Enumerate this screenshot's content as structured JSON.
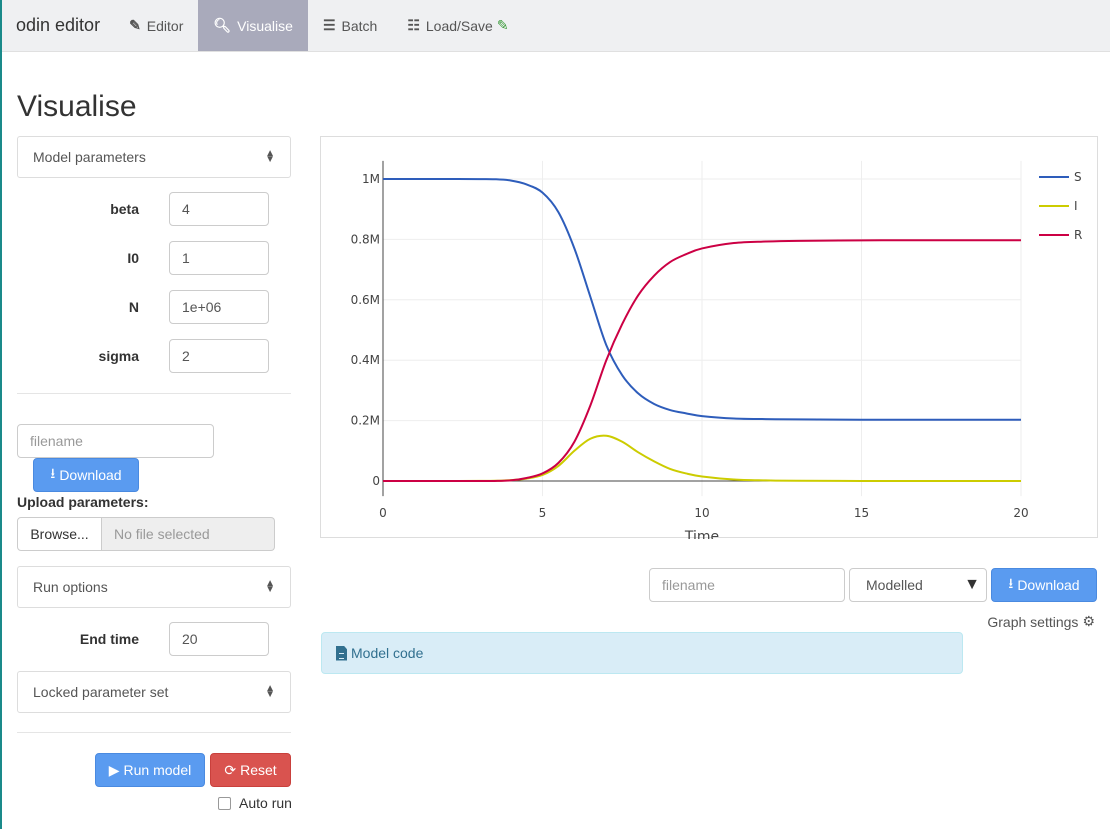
{
  "navbar": {
    "brand": "odin editor",
    "tabs": [
      {
        "label": "Editor",
        "icon": "edit-icon",
        "active": false
      },
      {
        "label": "Visualise",
        "icon": "search-icon",
        "active": true
      },
      {
        "label": "Batch",
        "icon": "bars-icon",
        "active": false
      },
      {
        "label": "Load/Save",
        "icon": "list-icon",
        "active": false,
        "badge_icon": "edit-icon"
      }
    ]
  },
  "page_title": "Visualise",
  "sidebar": {
    "model_parameters_label": "Model parameters",
    "parameters": [
      {
        "name": "beta",
        "value": "4"
      },
      {
        "name": "I0",
        "value": "1"
      },
      {
        "name": "N",
        "value": "1e+06"
      },
      {
        "name": "sigma",
        "value": "2"
      }
    ],
    "filename_placeholder": "filename",
    "download_label": "Download",
    "upload_label": "Upload parameters:",
    "browse_label": "Browse...",
    "no_file_label": "No file selected",
    "run_options_label": "Run options",
    "end_time_label": "End time",
    "end_time_value": "20",
    "locked_parameter_set_label": "Locked parameter set",
    "run_model_label": "Run model",
    "reset_label": "Reset",
    "auto_run_label": "Auto run",
    "auto_run_checked": false
  },
  "main": {
    "filename_placeholder": "filename",
    "select_value": "Modelled",
    "download_label": "Download",
    "graph_settings_label": "Graph settings",
    "model_code_label": "Model code"
  },
  "colors": {
    "S": "#2e5dbb",
    "I": "#cccc00",
    "R": "#cc0044",
    "primary": "#5a9bf0",
    "danger": "#d9534f",
    "active_tab": "#a9aabb"
  },
  "chart_data": {
    "type": "line",
    "title": "",
    "xlabel": "Time",
    "ylabel": "",
    "xlim": [
      0,
      20
    ],
    "ylim": [
      -50000,
      1060000
    ],
    "xticks": [
      0,
      5,
      10,
      15,
      20
    ],
    "yticks": [
      0,
      200000,
      400000,
      600000,
      800000,
      1000000
    ],
    "ytick_labels": [
      "0",
      "0.2M",
      "0.4M",
      "0.6M",
      "0.8M",
      "1M"
    ],
    "grid": true,
    "legend_position": "top-right",
    "x": [
      0,
      1,
      2,
      3,
      3.5,
      4,
      4.5,
      5,
      5.5,
      6,
      6.5,
      7,
      7.5,
      8,
      8.5,
      9,
      9.5,
      10,
      11,
      12,
      13,
      15,
      17,
      20
    ],
    "series": [
      {
        "name": "S",
        "values": [
          1000000,
          999990,
          999950,
          999700,
          999200,
          995000,
          982000,
          955000,
          890000,
          770000,
          610000,
          450000,
          350000,
          290000,
          255000,
          235000,
          224000,
          215000,
          207000,
          205000,
          204000,
          203000,
          203000,
          203000
        ]
      },
      {
        "name": "I",
        "values": [
          1,
          7,
          50,
          300,
          700,
          3000,
          8000,
          20000,
          50000,
          100000,
          140000,
          150000,
          130000,
          95000,
          65000,
          40000,
          25000,
          15000,
          5000,
          2000,
          700,
          100,
          10,
          0
        ]
      },
      {
        "name": "R",
        "values": [
          0,
          3,
          0,
          0,
          100,
          2000,
          10000,
          25000,
          60000,
          130000,
          250000,
          400000,
          520000,
          615000,
          680000,
          725000,
          751000,
          770000,
          788000,
          793000,
          795300,
          796900,
          797000,
          797000
        ]
      }
    ]
  }
}
